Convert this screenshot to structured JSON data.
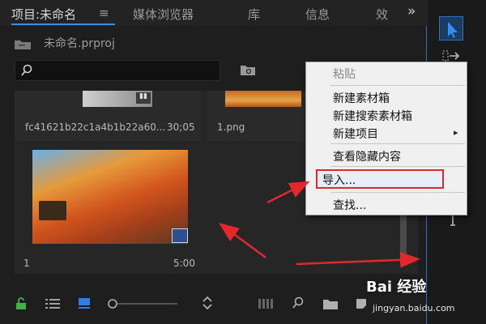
{
  "tabs": [
    {
      "label": "项目:未命名"
    },
    {
      "label": "≡"
    },
    {
      "label": "媒体浏览器"
    },
    {
      "label": "库"
    },
    {
      "label": "信息"
    },
    {
      "label": "效"
    },
    {
      "label": "»"
    }
  ],
  "project": {
    "file_name": "未命名.prproj"
  },
  "search": {
    "placeholder": ""
  },
  "clips": [
    {
      "name": "fc41621b22c1a4b1b22a60...",
      "duration": "30;05"
    },
    {
      "name": "1.png",
      "duration": ""
    },
    {
      "name": "1",
      "duration": "5:00"
    }
  ],
  "context_menu": {
    "items": [
      {
        "label": "粘贴",
        "enabled": false
      },
      {
        "label": "新建素材箱",
        "enabled": true
      },
      {
        "label": "新建搜索素材箱",
        "enabled": true
      },
      {
        "label": "新建项目",
        "enabled": true,
        "submenu_arrow": "▸"
      },
      {
        "label": "查看隐藏内容",
        "enabled": true
      },
      {
        "label": "导入...",
        "enabled": true
      },
      {
        "label": "查找...",
        "enabled": true
      }
    ]
  },
  "watermark": {
    "brand": "Bai  经验",
    "url": "jingyan.baidu.com"
  },
  "colors": {
    "accent": "#3a8ee6",
    "annotation": "#e4262d",
    "tool_selected": "#2f6fbf"
  },
  "icons": {
    "folder": "folder-icon",
    "search": "search-icon",
    "new_bin": "new-bin-icon",
    "lock": "lock-icon",
    "list": "list-view-icon",
    "icon_view": "icon-view-icon",
    "zoom": "zoom-slider-icon",
    "sort": "sort-icon",
    "auto": "automate-icon",
    "find": "find-icon",
    "folder2": "folder-icon",
    "new_item": "new-item-icon",
    "trash": "trash-icon",
    "select_tool": "selection-tool-icon",
    "track_tool": "track-select-icon"
  }
}
